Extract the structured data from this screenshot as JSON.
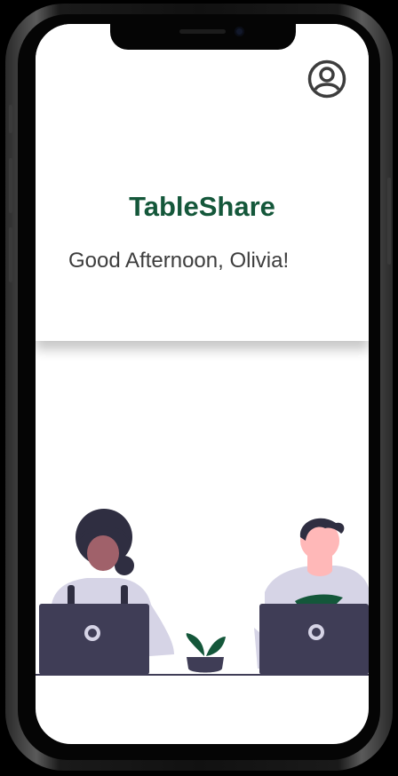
{
  "app": {
    "title": "TableShare",
    "greeting": "Good Afternoon, Olivia!"
  },
  "icons": {
    "profile": "user-circle-icon"
  },
  "colors": {
    "brand": "#14573a",
    "text": "#3d3d3d",
    "laptop": "#3f3d56",
    "shirt": "#d6d4e6",
    "plant": "#14573a"
  }
}
